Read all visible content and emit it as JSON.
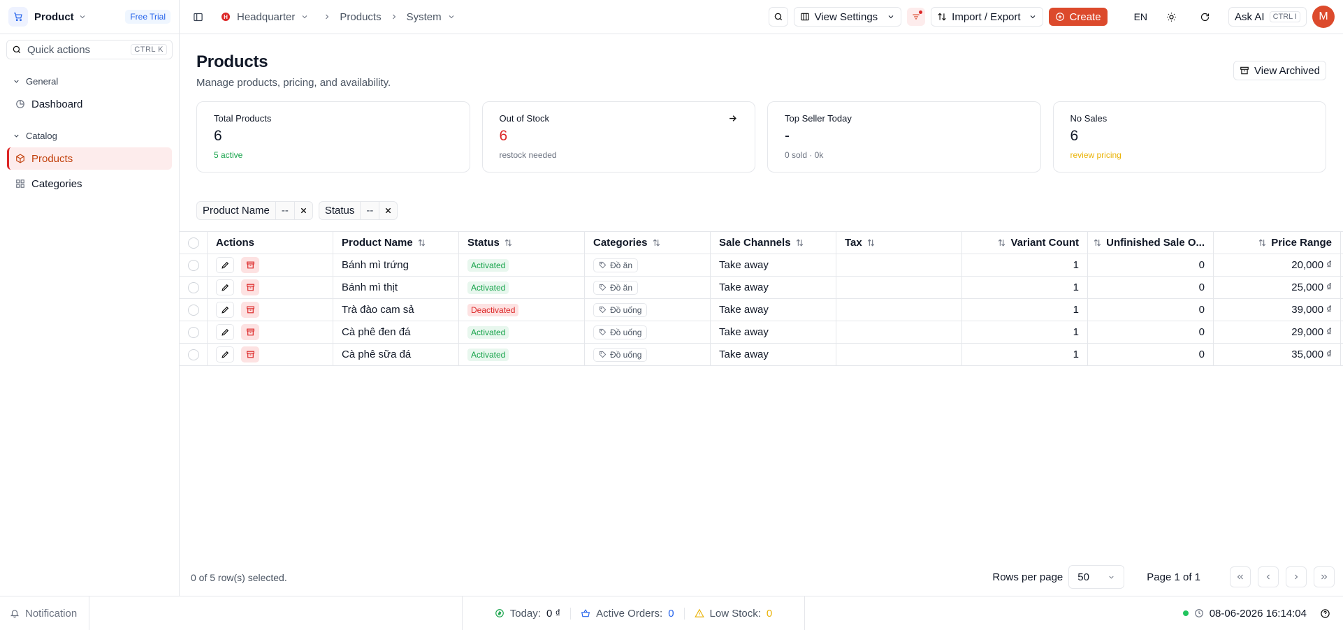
{
  "app": {
    "name": "Product",
    "trial_badge": "Free Trial",
    "quick_actions": {
      "placeholder": "Quick actions",
      "shortcut": "CTRL K"
    }
  },
  "sidebar": {
    "groups": [
      {
        "label": "General",
        "items": [
          {
            "label": "Dashboard",
            "icon": "pie-chart-icon",
            "active": false
          }
        ]
      },
      {
        "label": "Catalog",
        "items": [
          {
            "label": "Products",
            "icon": "box-icon",
            "active": true
          },
          {
            "label": "Categories",
            "icon": "grid-icon",
            "active": false
          }
        ]
      }
    ]
  },
  "topbar": {
    "breadcrumb": [
      {
        "label": "Headquarter",
        "badge": "H",
        "dropdown": true
      },
      {
        "label": "Products",
        "dropdown": false
      },
      {
        "label": "System",
        "dropdown": true
      }
    ],
    "view_settings": "View Settings",
    "import_export": "Import / Export",
    "create": "Create",
    "language": "EN",
    "ask_ai": "Ask AI",
    "ask_ai_shortcut": "CTRL I",
    "avatar_initial": "M"
  },
  "page": {
    "title": "Products",
    "subtitle": "Manage products, pricing, and availability.",
    "view_archived": "View Archived"
  },
  "cards": [
    {
      "label": "Total Products",
      "value": "6",
      "note": "5 active",
      "value_color": "#111827",
      "note_color": "#16a34a",
      "arrow": false
    },
    {
      "label": "Out of Stock",
      "value": "6",
      "note": "restock needed",
      "value_color": "#dc2626",
      "note_color": "#6b7280",
      "arrow": true
    },
    {
      "label": "Top Seller Today",
      "value": "-",
      "note": "0 sold · 0k",
      "value_color": "#111827",
      "note_color": "#6b7280",
      "arrow": false
    },
    {
      "label": "No Sales",
      "value": "6",
      "note": "review pricing",
      "value_color": "#111827",
      "note_color": "#eab308",
      "arrow": false
    }
  ],
  "filters": [
    {
      "label": "Product Name",
      "value": "--"
    },
    {
      "label": "Status",
      "value": "--"
    }
  ],
  "table": {
    "columns": [
      "Actions",
      "Product Name",
      "Status",
      "Categories",
      "Sale Channels",
      "Tax",
      "Variant Count",
      "Unfinished Sale O...",
      "Price Range"
    ],
    "rows": [
      {
        "name": "Bánh mì trứng",
        "status": "Activated",
        "active": true,
        "category": "Đồ ăn",
        "channel": "Take away",
        "tax": "",
        "variants": "1",
        "unfinished": "0",
        "price": "20,000 ₫"
      },
      {
        "name": "Bánh mì thịt",
        "status": "Activated",
        "active": true,
        "category": "Đồ ăn",
        "channel": "Take away",
        "tax": "",
        "variants": "1",
        "unfinished": "0",
        "price": "25,000 ₫"
      },
      {
        "name": "Trà đào cam sả",
        "status": "Deactivated",
        "active": false,
        "category": "Đồ uống",
        "channel": "Take away",
        "tax": "",
        "variants": "1",
        "unfinished": "0",
        "price": "39,000 ₫"
      },
      {
        "name": "Cà phê đen đá",
        "status": "Activated",
        "active": true,
        "category": "Đồ uống",
        "channel": "Take away",
        "tax": "",
        "variants": "1",
        "unfinished": "0",
        "price": "29,000 ₫"
      },
      {
        "name": "Cà phê sữa đá",
        "status": "Activated",
        "active": true,
        "category": "Đồ uống",
        "channel": "Take away",
        "tax": "",
        "variants": "1",
        "unfinished": "0",
        "price": "35,000 ₫"
      }
    ],
    "selection_info": "0 of 5 row(s) selected.",
    "rows_per_page_label": "Rows per page",
    "rows_per_page": "50",
    "page_info": "Page 1 of 1"
  },
  "footer": {
    "notification": "Notification",
    "today_label": "Today:",
    "today_value": "0 ₫",
    "orders_label": "Active Orders:",
    "orders_value": "0",
    "low_stock_label": "Low Stock:",
    "low_stock_value": "0",
    "datetime": "08-06-2026 16:14:04"
  },
  "colors": {
    "accent": "#dc4a2c",
    "active_green": "#16a34a",
    "danger": "#dc2626"
  }
}
